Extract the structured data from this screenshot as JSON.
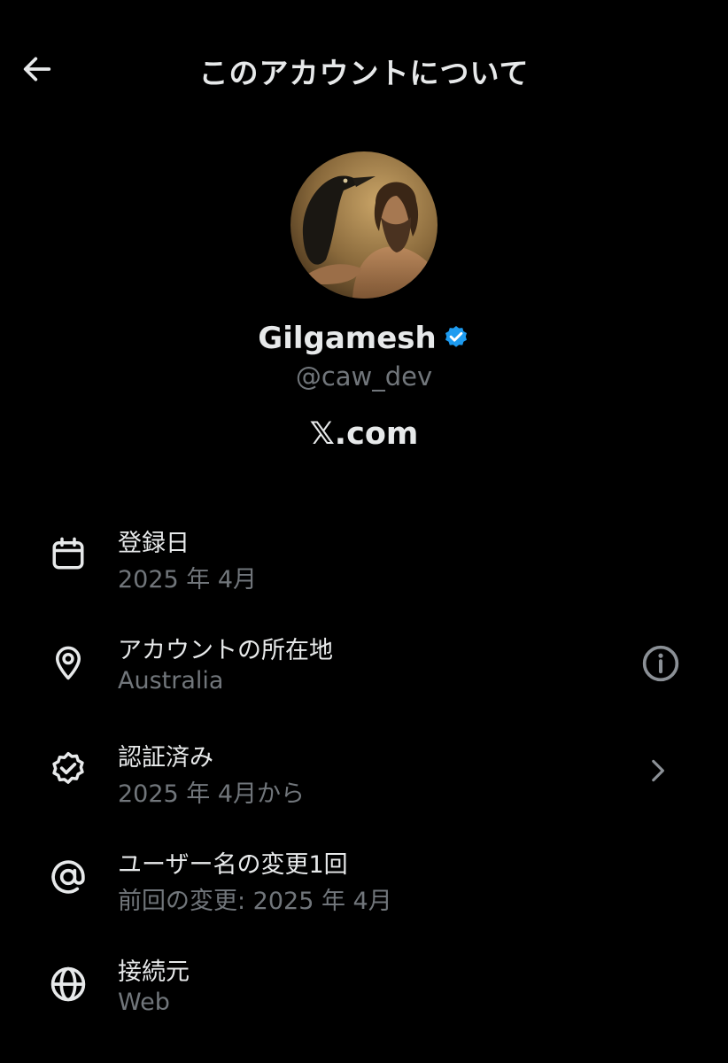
{
  "header": {
    "title": "このアカウントについて",
    "back_icon": "back-arrow-icon"
  },
  "profile": {
    "display_name": "Gilgamesh",
    "verified": true,
    "verified_color": "#1d9bf0",
    "handle": "@caw_dev",
    "site_link": "𝕏.com"
  },
  "rows": [
    {
      "icon": "calendar-icon",
      "label": "登録日",
      "value": "2025 年 4月",
      "trailing": null
    },
    {
      "icon": "location-pin-icon",
      "label": "アカウントの所在地",
      "value": "Australia",
      "trailing": "info-icon"
    },
    {
      "icon": "verified-badge-icon",
      "label": "認証済み",
      "value": "2025 年 4月から",
      "trailing": "chevron-right-icon"
    },
    {
      "icon": "at-sign-icon",
      "label": "ユーザー名の変更1回",
      "value": "前回の変更: 2025 年 4月",
      "trailing": null
    },
    {
      "icon": "globe-icon",
      "label": "接続元",
      "value": "Web",
      "trailing": null
    }
  ],
  "colors": {
    "background": "#000000",
    "primary_text": "#e7e9ea",
    "secondary_text": "#71767b",
    "accent": "#1d9bf0"
  }
}
